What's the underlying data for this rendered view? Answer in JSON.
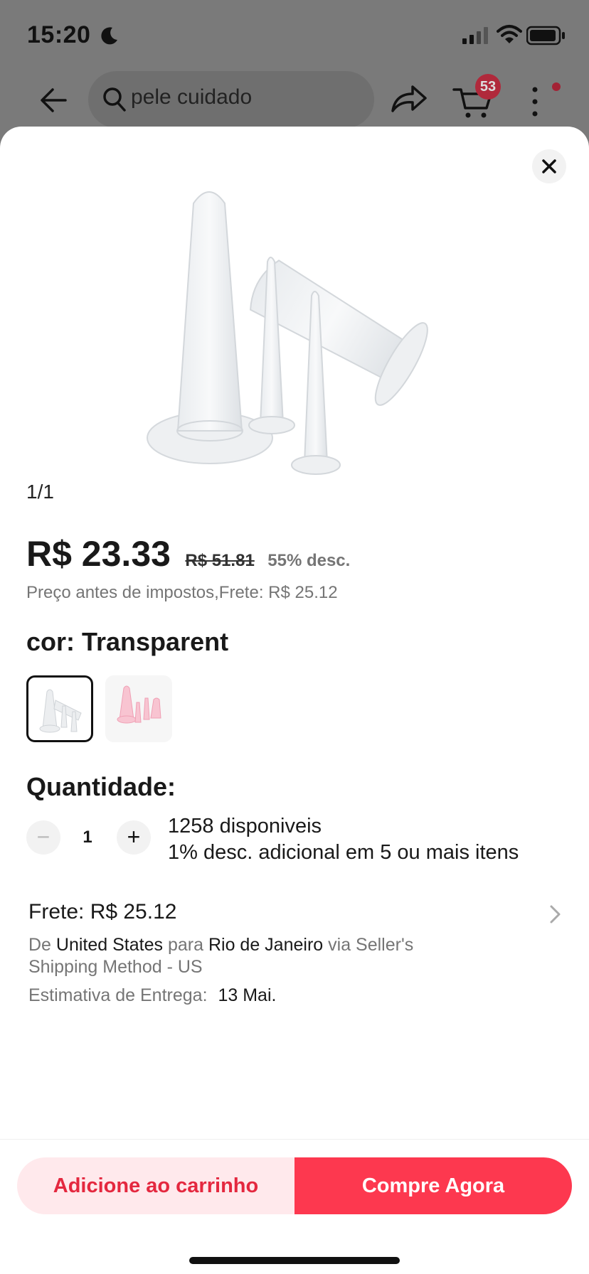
{
  "status_bar": {
    "time": "15:20",
    "icons": [
      "moon-icon",
      "signal-icon",
      "wifi-icon",
      "battery-icon"
    ]
  },
  "top_bar": {
    "search_text": "pele cuidado",
    "cart_count": "53",
    "icons": [
      "back-icon",
      "search-icon",
      "share-icon",
      "cart-icon",
      "more-icon"
    ]
  },
  "sheet": {
    "image_counter": "1/1",
    "price": {
      "current": "R$ 23.33",
      "original": "R$ 51.81",
      "discount": "55% desc."
    },
    "tax_note": "Preço antes de impostos,Frete: R$ 25.12",
    "color": {
      "title": "cor: Transparent",
      "options": [
        {
          "name": "Transparent",
          "selected": true,
          "tint": "#dfe3e6"
        },
        {
          "name": "Pink",
          "selected": false,
          "tint": "#f6b8c8"
        }
      ]
    },
    "quantity": {
      "title": "Quantidade:",
      "value": "1",
      "minus": "−",
      "plus": "+",
      "available": "1258 disponiveis",
      "bulk_discount": "1% desc. adicional em 5 ou mais itens"
    },
    "shipping": {
      "title": "Frete: R$ 25.12",
      "from_prefix": "De",
      "origin": "United States",
      "to_prefix": "para",
      "destination": "Rio de Janeiro",
      "method": "via Seller's Shipping Method - US",
      "eta_label": "Estimativa de Entrega:",
      "eta_value": "13 Mai."
    },
    "actions": {
      "add_to_cart": "Adicione ao carrinho",
      "buy_now": "Compre Agora"
    }
  },
  "colors": {
    "accent": "#fd384f",
    "accent_light": "#ffe9ec",
    "text_primary": "#191919",
    "text_secondary": "#757575",
    "overlay": "#7a7a7a"
  }
}
